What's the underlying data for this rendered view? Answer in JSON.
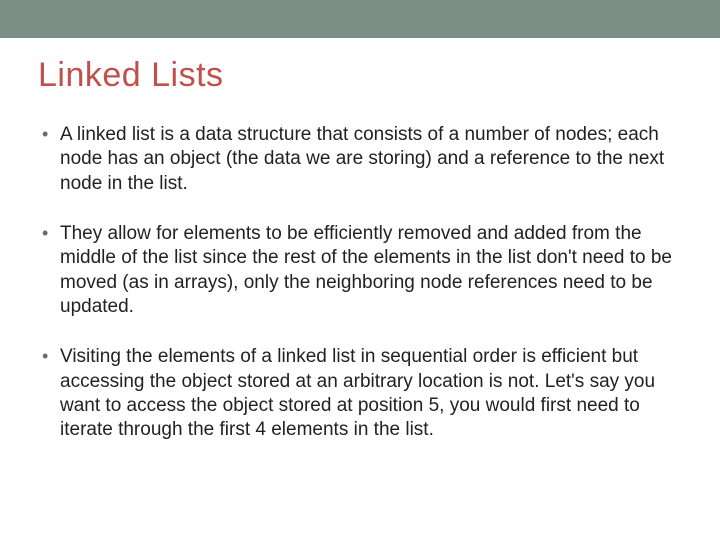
{
  "slide": {
    "title": "Linked Lists",
    "bullets": [
      "A linked list is a data structure that consists of a number of nodes; each node has an object (the data we are storing) and a reference to the next node in the list.",
      "They allow for elements to be efficiently removed and added from the middle of the list since the rest of the elements in the list don't need to be moved (as in arrays), only the neighboring node references need to be updated.",
      "Visiting the elements of a linked list in sequential order is efficient but accessing the object stored at an arbitrary location is not. Let's say you want to access the object stored at position 5, you would first need to iterate through the first 4 elements in the list."
    ]
  }
}
